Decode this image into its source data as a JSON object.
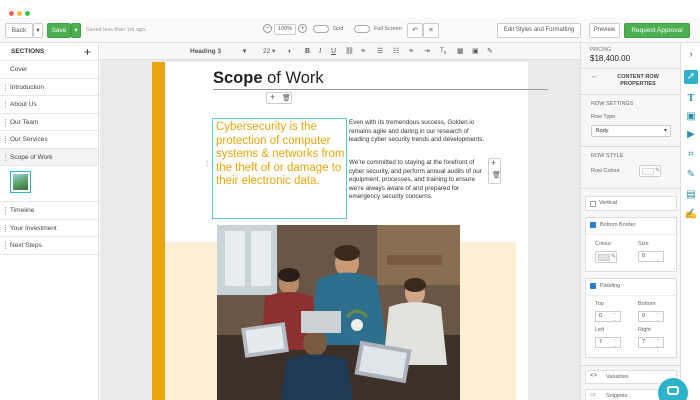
{
  "toolbar": {
    "back_label": "Back",
    "save_label": "Save",
    "saved_status": "Saved less than 1m ago.",
    "zoom_value": "100%",
    "grid_label": "Grid",
    "fullscreen_label": "Full Screen",
    "edit_styles_label": "Edit Styles and Formatting",
    "preview_label": "Preview",
    "request_approval_label": "Request Approval"
  },
  "sidebar": {
    "title": "SECTIONS",
    "items": [
      {
        "label": "Cover"
      },
      {
        "label": "Introduction"
      },
      {
        "label": "About Us"
      },
      {
        "label": "Our Team"
      },
      {
        "label": "Our Services"
      },
      {
        "label": "Scope of Work"
      },
      {
        "label": "Timeline"
      },
      {
        "label": "Your Investment"
      },
      {
        "label": "Next Steps"
      }
    ]
  },
  "format_bar": {
    "style_value": "Heading 3",
    "size_value": "22"
  },
  "document": {
    "heading_bold": "Scope",
    "heading_rest": " of Work",
    "callout": "Cybersecurity is the protection of computer systems & networks from the theft of or damage to their electronic data.",
    "para1": "Even with its tremendous success, Golden.io remains agile and daring in our research of leading cyber security trends and developments.",
    "para2": "We're committed to staying at the forefront of cyber security, and perform annual audits of our equipment, processes, and training to ensure we're always aware of and prepared for emergency security concerns."
  },
  "right_panel": {
    "pricing_label": "PRICING",
    "pricing_value": "$18,400.00",
    "panel_title_line1": "CONTENT ROW",
    "panel_title_line2": "PROPERTIES",
    "row_settings_label": "ROW SETTINGS",
    "row_type_label": "Row Type",
    "row_type_value": "Body",
    "row_style_label": "ROW STYLE",
    "row_colour_label": "Row Colour",
    "vertical_label": "Vertical",
    "bottom_border_label": "Bottom Border",
    "colour_label": "Colour",
    "size_label": "Size",
    "size_value": "0",
    "padding_label": "Padding",
    "top_label": "Top",
    "bottom_label": "Bottom",
    "left_label": "Left",
    "right_label": "Right",
    "top_value": "0",
    "bottom_value": "0",
    "left_value": "7",
    "right_value": "7",
    "variables_label": "Variables",
    "snippets_label": "Snippets"
  },
  "colors": {
    "accent_green": "#4caf50",
    "teal": "#2eb2c9",
    "callout_text": "#e6a60c",
    "gold_bar": "#e8a70e",
    "sand": "#fbf0d4"
  }
}
